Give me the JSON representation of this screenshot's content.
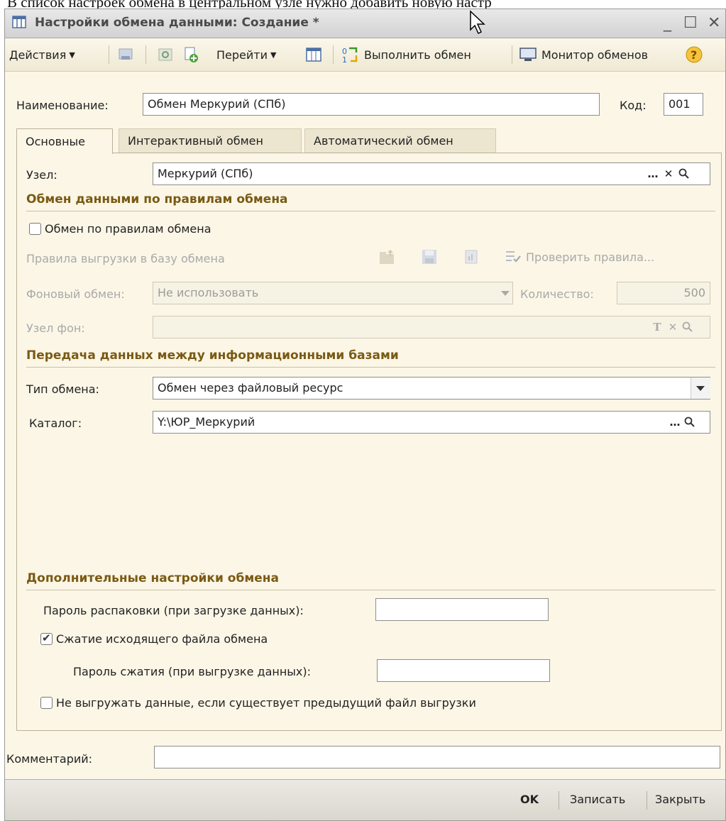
{
  "document_text": "В список настроек обмена в центральном узле нужно добавить новую настр",
  "window": {
    "title": "Настройки обмена данными: Создание *"
  },
  "toolbar": {
    "actions": "Действия",
    "goto": "Перейти",
    "execute_exchange": "Выполнить обмен",
    "exchange_monitor": "Монитор обменов"
  },
  "header": {
    "name_label": "Наименование:",
    "name_value": "Обмен Меркурий  (СПб)",
    "code_label": "Код:",
    "code_value": "001"
  },
  "tabs": [
    {
      "label": "Основные",
      "active": true
    },
    {
      "label": "Интерактивный обмен",
      "active": false
    },
    {
      "label": "Автоматический обмен",
      "active": false
    }
  ],
  "main": {
    "node_label": "Узел:",
    "node_value": "Меркурий  (СПб)",
    "rules_section": "Обмен данными по правилам обмена",
    "rules_checkbox": "Обмен по правилам обмена",
    "rules_checked": false,
    "upload_rules_label": "Правила выгрузки в базу обмена",
    "check_rules": "Проверить правила...",
    "background_label": "Фоновый обмен:",
    "background_value": "Не использовать",
    "quantity_label": "Количество:",
    "quantity_value": "500",
    "bg_node_label": "Узел фон:",
    "bg_node_value": "",
    "transfer_section": "Передача данных между информационными базами",
    "exchange_type_label": "Тип обмена:",
    "exchange_type_value": "Обмен через файловый ресурс",
    "catalog_label": "Каталог:",
    "catalog_value": "Y:\\ЮР_Меркурий",
    "extra_section": "Дополнительные настройки обмена",
    "unpack_password_label": "Пароль распаковки (при загрузке данных):",
    "unpack_password_value": "",
    "compress_checkbox": "Сжатие исходящего файла обмена",
    "compress_checked": true,
    "compress_password_label": "Пароль сжатия (при выгрузке данных):",
    "compress_password_value": "",
    "no_upload_checkbox": "Не выгружать данные, если существует предыдущий файл выгрузки",
    "no_upload_checked": false
  },
  "comment": {
    "label": "Комментарий:",
    "value": ""
  },
  "footer": {
    "ok": "OK",
    "save": "Записать",
    "close": "Закрыть"
  },
  "colors": {
    "window_bg": "#fbf6e6",
    "section_title": "#7a5a14",
    "footer_bg": "#dad7cd"
  }
}
